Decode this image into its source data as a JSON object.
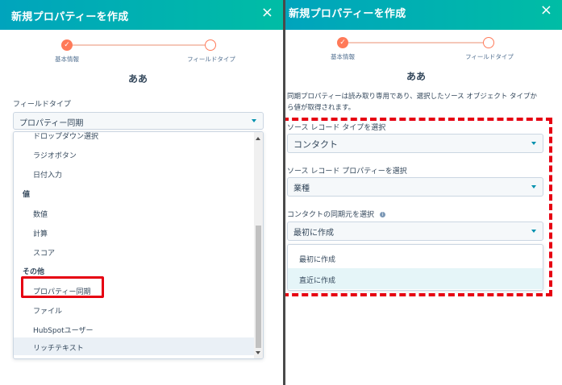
{
  "left": {
    "header": {
      "title": "新規プロパティーを作成",
      "close_icon": "×"
    },
    "stepper": {
      "step1": "基本情報",
      "step2": "フィールドタイプ"
    },
    "property_name": "ああ",
    "field_type_label": "フィールドタイプ",
    "field_type_value": "プロパティー同期",
    "dropdown": {
      "partial_item": "ドロップダウン選択",
      "items_a": [
        "ラジオボタン",
        "日付入力"
      ],
      "group_value": "値",
      "items_b": [
        "数値",
        "計算",
        "スコア"
      ],
      "group_other": "その他",
      "items_c": [
        "プロパティー同期",
        "ファイル",
        "HubSpotユーザー",
        "リッチテキスト"
      ]
    }
  },
  "right": {
    "header": {
      "title": "新規プロパティーを作成",
      "close_icon": "×"
    },
    "stepper": {
      "step1": "基本情報",
      "step2": "フィールドタイプ"
    },
    "property_name": "ああ",
    "description_line1": "同期プロパティーは読み取り専用であり、選択したソース オブジェクト タイプか",
    "description_line2": "ら値が取得されます。",
    "source_type_label": "ソース レコード タイプを選択",
    "source_type_value": "コンタクト",
    "source_property_label": "ソース レコード プロパティーを選択",
    "source_property_value": "業種",
    "sync_source_label": "コンタクトの同期元を選択",
    "sync_source_info_icon": "i",
    "sync_source_value": "最初に作成",
    "sync_options": [
      "最初に作成",
      "直近に作成"
    ]
  },
  "colors": {
    "header_start": "#00a4bd",
    "header_end": "#00bda5",
    "accent": "#ff7a59",
    "highlight": "#e60012",
    "caret": "#0091ae"
  }
}
